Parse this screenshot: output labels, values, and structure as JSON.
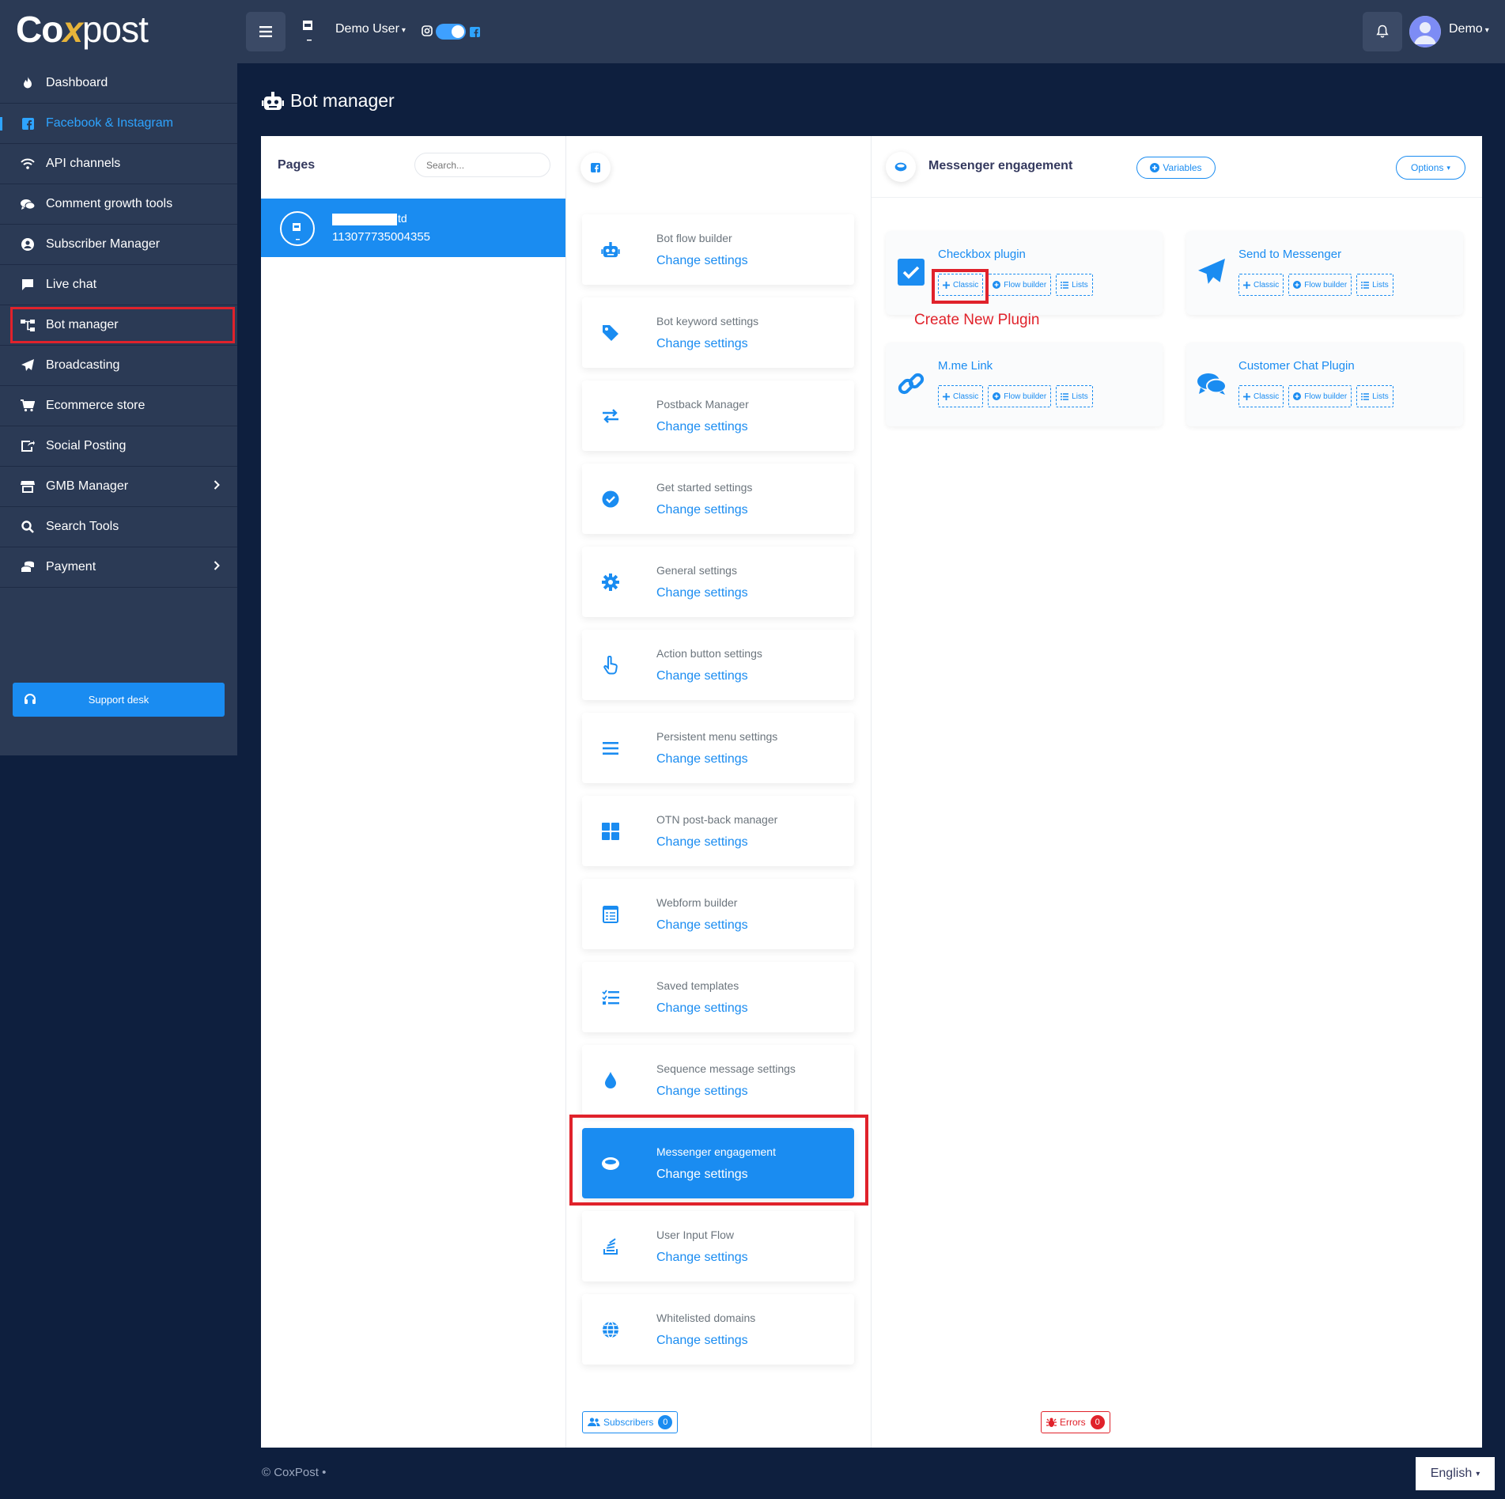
{
  "brand": {
    "logo_part1": "Co",
    "logo_x": "x",
    "logo_part2": "post"
  },
  "topbar": {
    "user_label": "Demo User",
    "account_label": "Demo",
    "toggle_on": true
  },
  "sidebar": {
    "items": [
      {
        "label": "Dashboard",
        "icon": "fire-icon"
      },
      {
        "label": "Facebook & Instagram",
        "icon": "facebook-icon"
      },
      {
        "label": "API channels",
        "icon": "wifi-icon"
      },
      {
        "label": "Comment growth tools",
        "icon": "comments-icon"
      },
      {
        "label": "Subscriber Manager",
        "icon": "user-circle-icon"
      },
      {
        "label": "Live chat",
        "icon": "chat-icon"
      },
      {
        "label": "Bot manager",
        "icon": "sitemap-icon"
      },
      {
        "label": "Broadcasting",
        "icon": "paper-plane-icon"
      },
      {
        "label": "Ecommerce store",
        "icon": "cart-icon"
      },
      {
        "label": "Social Posting",
        "icon": "share-icon"
      },
      {
        "label": "GMB Manager",
        "icon": "store-icon"
      },
      {
        "label": "Search Tools",
        "icon": "search-icon"
      },
      {
        "label": "Payment",
        "icon": "coins-icon"
      }
    ],
    "support_label": "Support desk"
  },
  "page_title": "Bot manager",
  "pages_panel": {
    "title": "Pages",
    "search_placeholder": "Search...",
    "selected_page": {
      "name_suffix": "td",
      "id": "113077735004355"
    }
  },
  "settings": {
    "items": [
      {
        "title": "Bot flow builder",
        "link": "Change settings",
        "icon": "robot-icon"
      },
      {
        "title": "Bot keyword settings",
        "link": "Change settings",
        "icon": "tag-icon"
      },
      {
        "title": "Postback Manager",
        "link": "Change settings",
        "icon": "exchange-icon"
      },
      {
        "title": "Get started settings",
        "link": "Change settings",
        "icon": "check-circle-icon"
      },
      {
        "title": "General settings",
        "link": "Change settings",
        "icon": "cog-icon"
      },
      {
        "title": "Action button settings",
        "link": "Change settings",
        "icon": "hand-pointer-icon"
      },
      {
        "title": "Persistent menu settings",
        "link": "Change settings",
        "icon": "bars-icon"
      },
      {
        "title": "OTN post-back manager",
        "link": "Change settings",
        "icon": "th-large-icon"
      },
      {
        "title": "Webform builder",
        "link": "Change settings",
        "icon": "form-icon"
      },
      {
        "title": "Saved templates",
        "link": "Change settings",
        "icon": "tasks-icon"
      },
      {
        "title": "Sequence message settings",
        "link": "Change settings",
        "icon": "tint-icon"
      },
      {
        "title": "Messenger engagement",
        "link": "Change settings",
        "icon": "ring-icon"
      },
      {
        "title": "User Input Flow",
        "link": "Change settings",
        "icon": "stack-icon"
      },
      {
        "title": "Whitelisted domains",
        "link": "Change settings",
        "icon": "globe-icon"
      }
    ],
    "subscribers_label": "Subscribers",
    "subscribers_count": "0",
    "errors_label": "Errors",
    "errors_count": "0"
  },
  "engagement": {
    "title": "Messenger engagement",
    "variables_label": "Variables",
    "options_label": "Options",
    "plugins": [
      {
        "title": "Checkbox plugin",
        "icon": "checkbox-icon"
      },
      {
        "title": "Send to Messenger",
        "icon": "paper-plane-icon"
      },
      {
        "title": "M.me Link",
        "icon": "link-icon"
      },
      {
        "title": "Customer Chat Plugin",
        "icon": "comments-icon"
      }
    ],
    "btn_classic": "Classic",
    "btn_flow": "Flow builder",
    "btn_lists": "Lists",
    "annotation": "Create New Plugin"
  },
  "footer": {
    "copyright": "© CoxPost  •",
    "language": "English"
  },
  "colors": {
    "accent": "#1a8cf1",
    "sidebar": "#2b3a55",
    "background": "#0e1f3e",
    "highlight": "#e0222b"
  }
}
